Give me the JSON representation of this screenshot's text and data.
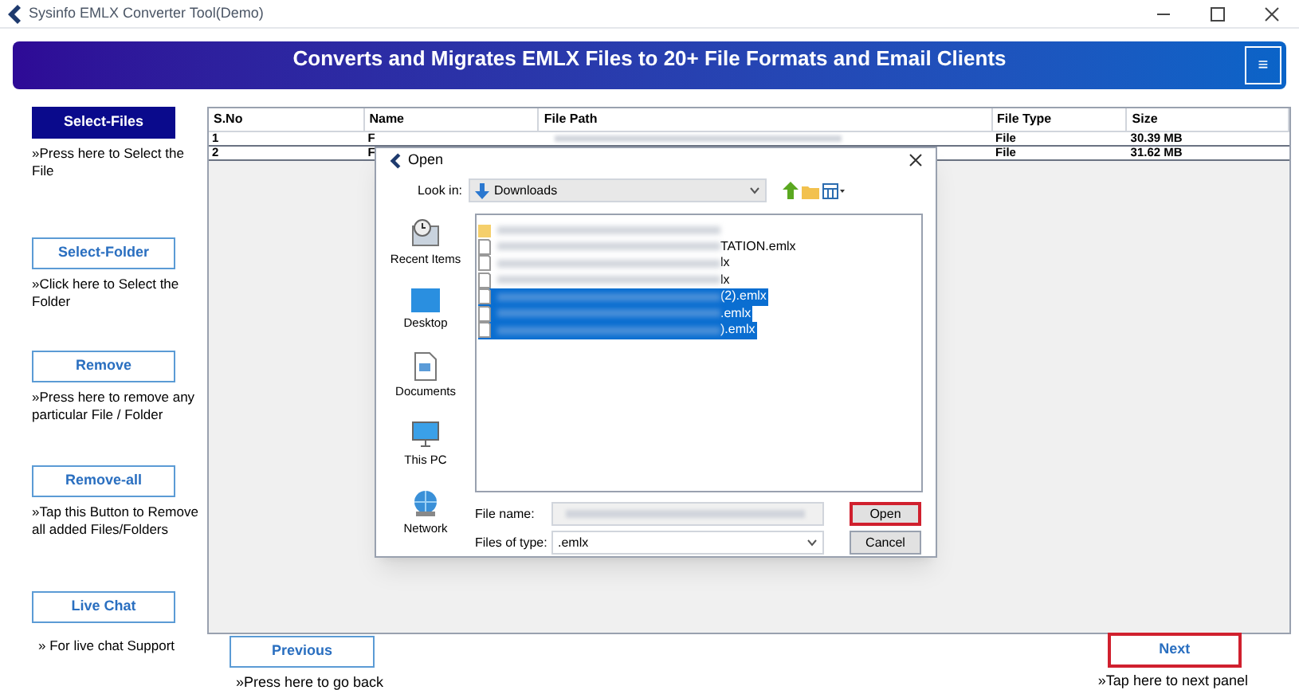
{
  "window": {
    "title": "Sysinfo EMLX Converter Tool(Demo)"
  },
  "banner": {
    "title": "Converts and Migrates EMLX Files to 20+ File Formats and Email Clients",
    "menu_button": "≡"
  },
  "sidebar": [
    {
      "label": "Select-Files",
      "hint": "»Press here to Select the File",
      "selected": true
    },
    {
      "label": "Select-Folder",
      "hint": "»Click here to Select the Folder",
      "selected": false
    },
    {
      "label": "Remove",
      "hint": "»Press here to remove any particular File / Folder",
      "selected": false
    },
    {
      "label": "Remove-all",
      "hint": "»Tap this Button to Remove all added Files/Folders",
      "selected": false
    },
    {
      "label": "Live Chat",
      "hint": "» For live chat Support",
      "selected": false
    }
  ],
  "table": {
    "columns": [
      "S.No",
      "Name",
      "File Path",
      "File Type",
      "Size"
    ],
    "rows": [
      {
        "sno": "1",
        "name": "F",
        "type": "File",
        "size": "30.39 MB"
      },
      {
        "sno": "2",
        "name": "F",
        "type": "File",
        "size": "31.62 MB"
      }
    ]
  },
  "dialog": {
    "title": "Open",
    "look_in_label": "Look in:",
    "look_in": "Downloads",
    "places": [
      {
        "label": "Recent Items",
        "kind": "recent"
      },
      {
        "label": "Desktop",
        "kind": "desktop"
      },
      {
        "label": "Documents",
        "kind": "documents"
      },
      {
        "label": "This PC",
        "kind": "pc"
      },
      {
        "label": "Network",
        "kind": "network"
      }
    ],
    "files": [
      {
        "kind": "folder",
        "selected": false
      },
      {
        "kind": "file",
        "name": "TATION.emlx",
        "selected": false
      },
      {
        "kind": "file",
        "name": "lx",
        "selected": false
      },
      {
        "kind": "file",
        "name": "lx",
        "selected": false
      },
      {
        "kind": "file",
        "name": "(2).emlx",
        "selected": true
      },
      {
        "kind": "file",
        "name": ".emlx",
        "selected": true
      },
      {
        "kind": "file",
        "name": ").emlx",
        "selected": true
      }
    ],
    "file_name_label": "File name:",
    "file_type_label": "Files of type:",
    "file_type": ".emlx",
    "open_button": {
      "label": "Open",
      "highlighted": true
    },
    "cancel_button": {
      "label": "Cancel",
      "highlighted": false
    }
  },
  "footer": {
    "previous": {
      "label": "Previous",
      "hint": "»Press here to go back"
    },
    "next": {
      "label": "Next",
      "hint": "»Tap here to next panel",
      "highlighted": true
    }
  }
}
